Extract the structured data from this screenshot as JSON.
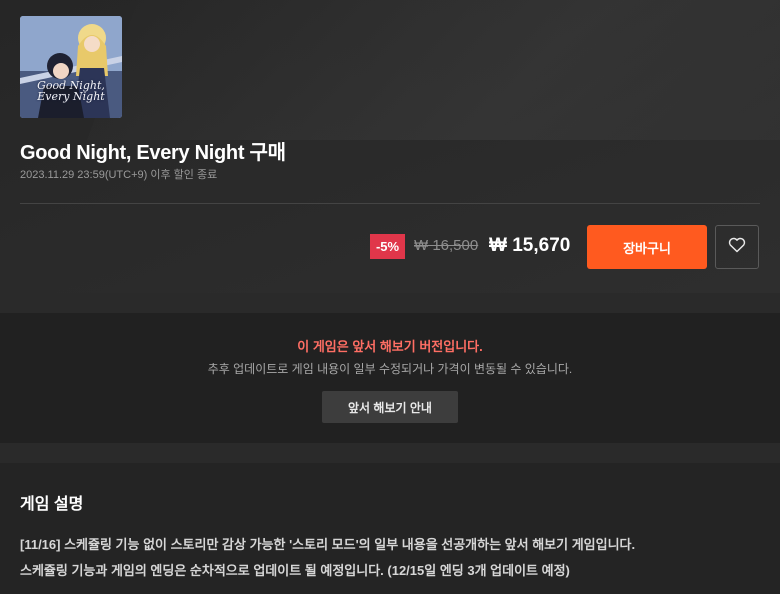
{
  "game": {
    "cover_title": "Good Night, Every Night",
    "title": "Good Night, Every Night 구매",
    "sale_end": "2023.11.29 23:59(UTC+9) 이후 할인 종료"
  },
  "price": {
    "discount": "-5%",
    "original": "₩ 16,500",
    "sale": "₩ 15,670",
    "accent_color": "#ff5a1f",
    "badge_color": "#e0364a"
  },
  "actions": {
    "cart_label": "장바구니",
    "wishlist_icon": "heart-icon"
  },
  "early_access": {
    "title": "이 게임은 앞서 해보기 버전입니다.",
    "description": "추후 업데이트로 게임 내용이 일부 수정되거나 가격이 변동될 수 있습니다.",
    "button_label": "앞서 해보기 안내"
  },
  "description": {
    "heading": "게임 설명",
    "lines": [
      "[11/16] 스케쥴링 기능 없이 스토리만 감상 가능한 '스토리 모드'의 일부 내용을 선공개하는 앞서 해보기 게임입니다.",
      "스케쥴링 기능과 게임의 엔딩은 순차적으로 업데이트 될 예정입니다. (12/15일 엔딩 3개 업데이트 예정)"
    ]
  }
}
